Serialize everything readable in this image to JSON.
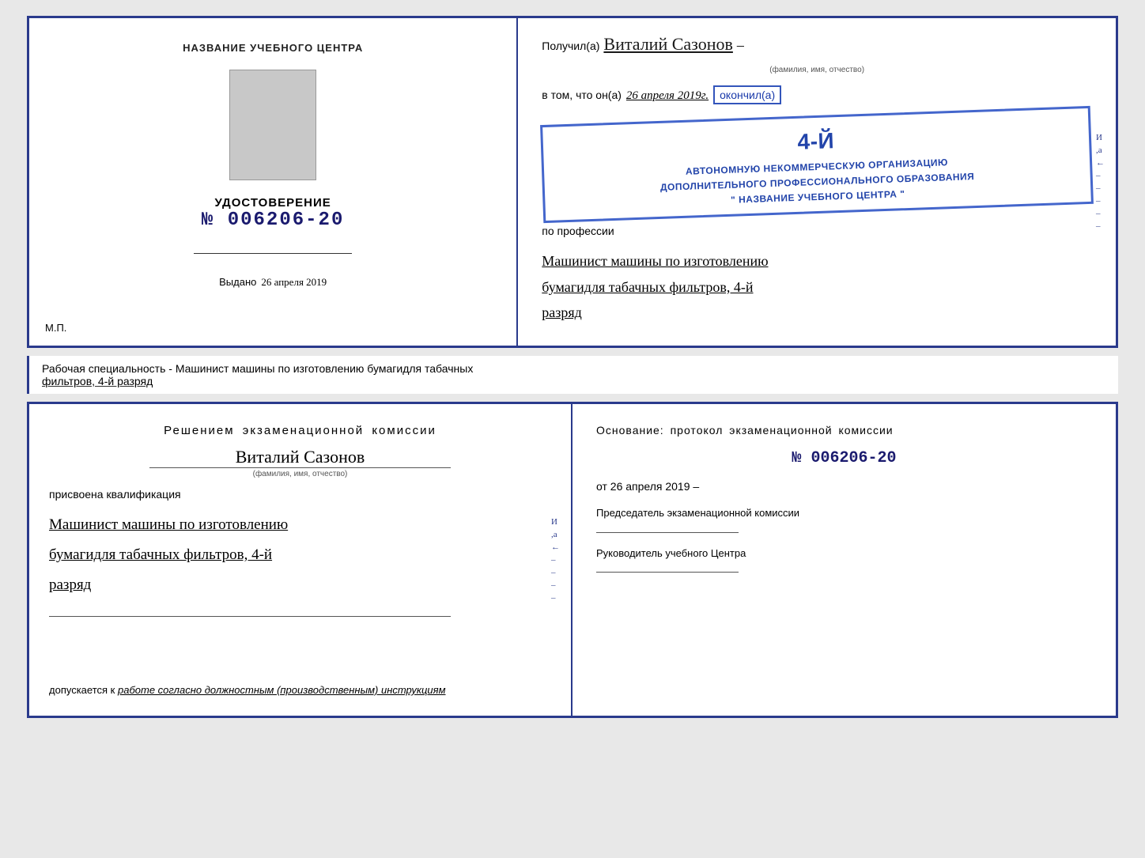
{
  "cert_top": {
    "left": {
      "title": "НАЗВАНИЕ УЧЕБНОГО ЦЕНТРА",
      "udost_label": "УДОСТОВЕРЕНИЕ",
      "number": "№ 006206-20",
      "vydano_label": "Выдано",
      "vydano_date": "26 апреля 2019",
      "mp_label": "М.П."
    },
    "right": {
      "poluchil_prefix": "Получил(а)",
      "name": "Виталий Сазонов",
      "fio_hint": "(фамилия, имя, отчество)",
      "dash": "–",
      "vtom_prefix": "в том, что он(а)",
      "vtom_date": "26 апреля 2019г.",
      "okonchil": "окончил(а)",
      "stamp_line1": "АВТОНОМНУЮ НЕКОММЕРЧЕСКУЮ ОРГАНИЗАЦИЮ",
      "stamp_line2": "ДОПОЛНИТЕЛЬНОГО ПРОФЕССИОНАЛЬНОГО ОБРАЗОВАНИЯ",
      "stamp_line3": "\" НАЗВАНИЕ УЧЕБНОГО ЦЕНТРА \"",
      "stamp_4": "4-й",
      "po_professii": "по профессии",
      "profession1": "Машинист машины по изготовлению",
      "profession2": "бумагидля табачных фильтров, 4-й",
      "profession3": "разряд"
    }
  },
  "info_strip": {
    "text_static": "Рабочая специальность - Машинист машины по изготовлению бумагидля табачных",
    "text_underlined": "фильтров, 4-й разряд"
  },
  "cert_bottom": {
    "left": {
      "resheniyem": "Решением  экзаменационной  комиссии",
      "name": "Виталий Сазонов",
      "fio_hint": "(фамилия, имя, отчество)",
      "prisvoena": "присвоена квалификация",
      "profession1": "Машинист машины по изготовлению",
      "profession2": "бумагидля табачных фильтров, 4-й",
      "profession3": "разряд",
      "dopusk_prefix": "допускается к",
      "dopusk_value": "работе согласно должностным (производственным) инструкциям"
    },
    "right": {
      "osnovanie": "Основание:  протокол  экзаменационной  комиссии",
      "number": "№  006206-20",
      "ot_prefix": "от",
      "ot_date": "26 апреля 2019",
      "predsedatel_label": "Председатель экзаменационной комиссии",
      "ruk_label": "Руководитель учебного Центра"
    }
  }
}
